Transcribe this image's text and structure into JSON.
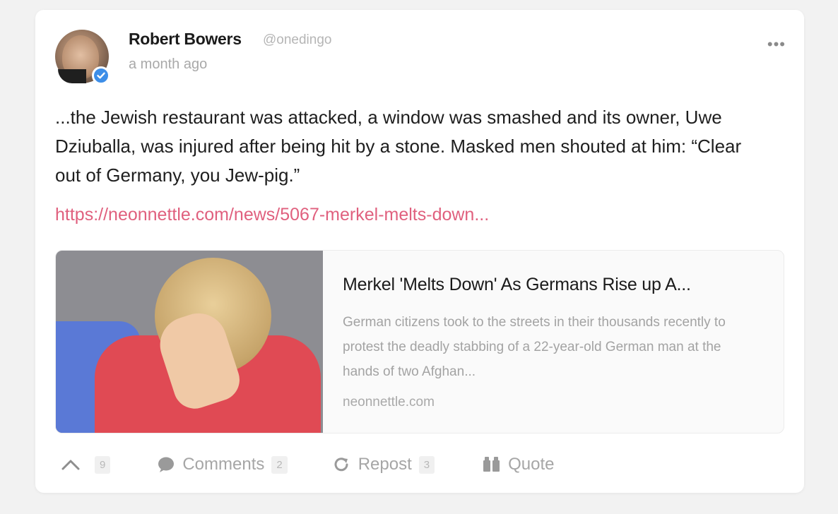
{
  "post": {
    "author": {
      "name": "Robert Bowers",
      "handle": "@onedingo",
      "time": "a month ago",
      "verified": true
    },
    "body": "...the Jewish restaurant was attacked, a window was smashed and its owner, Uwe Dziuballa, was injured after being hit by a stone. Masked men shouted at him: “Clear out of Germany, you Jew-pig.”",
    "link": "https://neonnettle.com/news/5067-merkel-melts-down...",
    "more_label": "•••"
  },
  "preview": {
    "title": "Merkel 'Melts Down' As Germans Rise up A...",
    "description": "German citizens took to the streets in their thousands recently to protest the deadly stabbing of a 22-year-old German man at the hands of two Afghan...",
    "domain": "neonnettle.com"
  },
  "actions": {
    "upvote_count": "9",
    "comments_label": "Comments",
    "comments_count": "2",
    "repost_label": "Repost",
    "repost_count": "3",
    "quote_label": "Quote"
  },
  "colors": {
    "link": "#e0607e",
    "verified": "#3d8ee8"
  }
}
